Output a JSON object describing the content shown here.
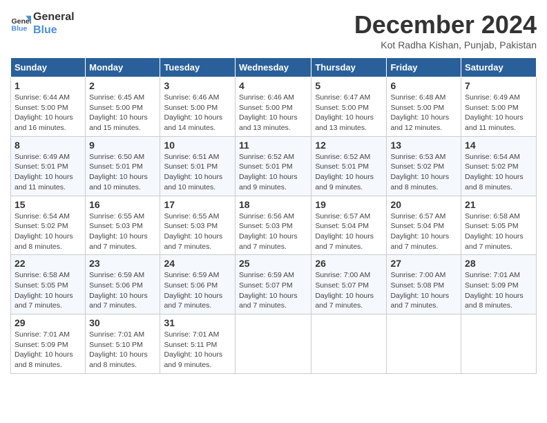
{
  "header": {
    "logo_line1": "General",
    "logo_line2": "Blue",
    "month_title": "December 2024",
    "location": "Kot Radha Kishan, Punjab, Pakistan"
  },
  "days_of_week": [
    "Sunday",
    "Monday",
    "Tuesday",
    "Wednesday",
    "Thursday",
    "Friday",
    "Saturday"
  ],
  "weeks": [
    [
      {
        "day": "1",
        "sunrise": "6:44 AM",
        "sunset": "5:00 PM",
        "daylight": "10 hours and 16 minutes."
      },
      {
        "day": "2",
        "sunrise": "6:45 AM",
        "sunset": "5:00 PM",
        "daylight": "10 hours and 15 minutes."
      },
      {
        "day": "3",
        "sunrise": "6:46 AM",
        "sunset": "5:00 PM",
        "daylight": "10 hours and 14 minutes."
      },
      {
        "day": "4",
        "sunrise": "6:46 AM",
        "sunset": "5:00 PM",
        "daylight": "10 hours and 13 minutes."
      },
      {
        "day": "5",
        "sunrise": "6:47 AM",
        "sunset": "5:00 PM",
        "daylight": "10 hours and 13 minutes."
      },
      {
        "day": "6",
        "sunrise": "6:48 AM",
        "sunset": "5:00 PM",
        "daylight": "10 hours and 12 minutes."
      },
      {
        "day": "7",
        "sunrise": "6:49 AM",
        "sunset": "5:00 PM",
        "daylight": "10 hours and 11 minutes."
      }
    ],
    [
      {
        "day": "8",
        "sunrise": "6:49 AM",
        "sunset": "5:01 PM",
        "daylight": "10 hours and 11 minutes."
      },
      {
        "day": "9",
        "sunrise": "6:50 AM",
        "sunset": "5:01 PM",
        "daylight": "10 hours and 10 minutes."
      },
      {
        "day": "10",
        "sunrise": "6:51 AM",
        "sunset": "5:01 PM",
        "daylight": "10 hours and 10 minutes."
      },
      {
        "day": "11",
        "sunrise": "6:52 AM",
        "sunset": "5:01 PM",
        "daylight": "10 hours and 9 minutes."
      },
      {
        "day": "12",
        "sunrise": "6:52 AM",
        "sunset": "5:01 PM",
        "daylight": "10 hours and 9 minutes."
      },
      {
        "day": "13",
        "sunrise": "6:53 AM",
        "sunset": "5:02 PM",
        "daylight": "10 hours and 8 minutes."
      },
      {
        "day": "14",
        "sunrise": "6:54 AM",
        "sunset": "5:02 PM",
        "daylight": "10 hours and 8 minutes."
      }
    ],
    [
      {
        "day": "15",
        "sunrise": "6:54 AM",
        "sunset": "5:02 PM",
        "daylight": "10 hours and 8 minutes."
      },
      {
        "day": "16",
        "sunrise": "6:55 AM",
        "sunset": "5:03 PM",
        "daylight": "10 hours and 7 minutes."
      },
      {
        "day": "17",
        "sunrise": "6:55 AM",
        "sunset": "5:03 PM",
        "daylight": "10 hours and 7 minutes."
      },
      {
        "day": "18",
        "sunrise": "6:56 AM",
        "sunset": "5:03 PM",
        "daylight": "10 hours and 7 minutes."
      },
      {
        "day": "19",
        "sunrise": "6:57 AM",
        "sunset": "5:04 PM",
        "daylight": "10 hours and 7 minutes."
      },
      {
        "day": "20",
        "sunrise": "6:57 AM",
        "sunset": "5:04 PM",
        "daylight": "10 hours and 7 minutes."
      },
      {
        "day": "21",
        "sunrise": "6:58 AM",
        "sunset": "5:05 PM",
        "daylight": "10 hours and 7 minutes."
      }
    ],
    [
      {
        "day": "22",
        "sunrise": "6:58 AM",
        "sunset": "5:05 PM",
        "daylight": "10 hours and 7 minutes."
      },
      {
        "day": "23",
        "sunrise": "6:59 AM",
        "sunset": "5:06 PM",
        "daylight": "10 hours and 7 minutes."
      },
      {
        "day": "24",
        "sunrise": "6:59 AM",
        "sunset": "5:06 PM",
        "daylight": "10 hours and 7 minutes."
      },
      {
        "day": "25",
        "sunrise": "6:59 AM",
        "sunset": "5:07 PM",
        "daylight": "10 hours and 7 minutes."
      },
      {
        "day": "26",
        "sunrise": "7:00 AM",
        "sunset": "5:07 PM",
        "daylight": "10 hours and 7 minutes."
      },
      {
        "day": "27",
        "sunrise": "7:00 AM",
        "sunset": "5:08 PM",
        "daylight": "10 hours and 7 minutes."
      },
      {
        "day": "28",
        "sunrise": "7:01 AM",
        "sunset": "5:09 PM",
        "daylight": "10 hours and 8 minutes."
      }
    ],
    [
      {
        "day": "29",
        "sunrise": "7:01 AM",
        "sunset": "5:09 PM",
        "daylight": "10 hours and 8 minutes."
      },
      {
        "day": "30",
        "sunrise": "7:01 AM",
        "sunset": "5:10 PM",
        "daylight": "10 hours and 8 minutes."
      },
      {
        "day": "31",
        "sunrise": "7:01 AM",
        "sunset": "5:11 PM",
        "daylight": "10 hours and 9 minutes."
      },
      null,
      null,
      null,
      null
    ]
  ]
}
